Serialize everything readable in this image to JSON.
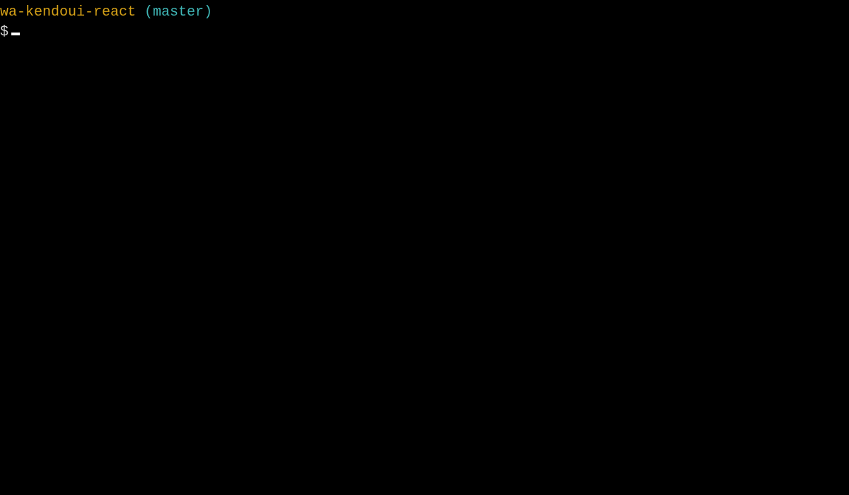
{
  "terminal": {
    "path": "wa-kendoui-react",
    "branch_open": " (",
    "branch": "master",
    "branch_close": ")",
    "prompt_symbol": "$"
  }
}
